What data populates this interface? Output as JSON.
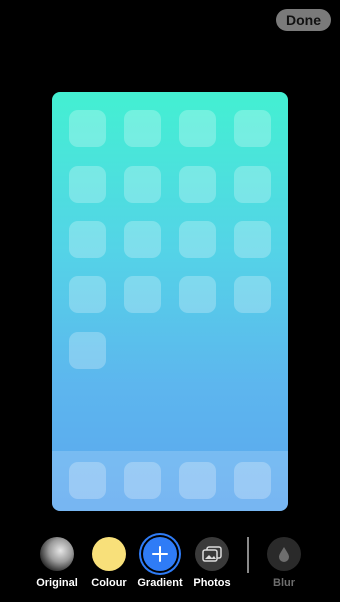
{
  "header": {
    "done_label": "Done"
  },
  "toolbar": {
    "items": [
      {
        "label": "Original",
        "icon": "moon-icon"
      },
      {
        "label": "Colour",
        "icon": "color-swatch-icon",
        "color": "#f8e07a"
      },
      {
        "label": "Gradient",
        "icon": "plus-icon",
        "color": "#2f7cf6"
      },
      {
        "label": "Photos",
        "icon": "photos-icon"
      },
      {
        "label": "Blur",
        "icon": "drop-icon"
      }
    ]
  },
  "preview": {
    "gradient_colors": [
      "#43f0d2",
      "#5aa6ef"
    ],
    "home_rows": 5,
    "dock_icons": 4
  }
}
